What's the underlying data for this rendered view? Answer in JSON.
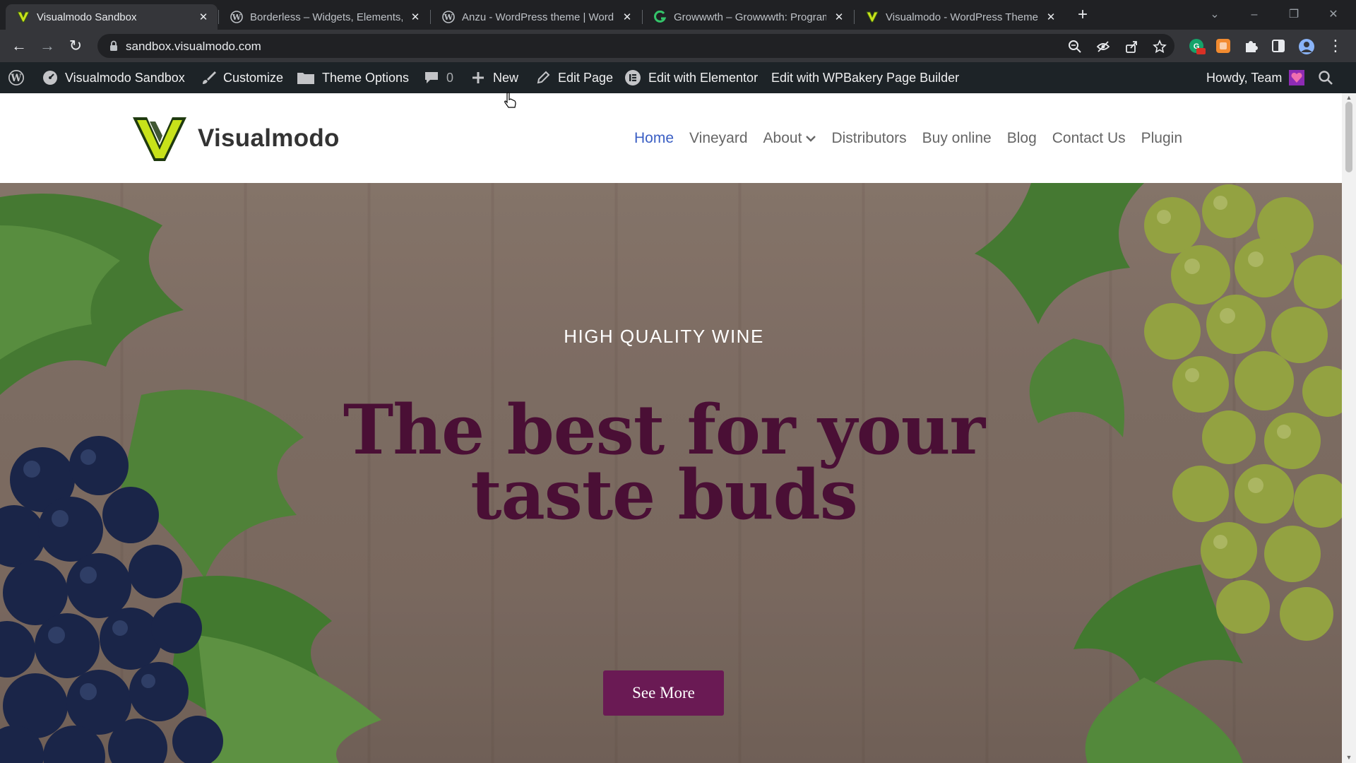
{
  "browser": {
    "tabs": [
      {
        "title": "Visualmodo Sandbox",
        "active": true,
        "favicon": "visualmodo-v-icon"
      },
      {
        "title": "Borderless – Widgets, Elements, T",
        "active": false,
        "favicon": "wordpress-icon"
      },
      {
        "title": "Anzu - WordPress theme | WordP",
        "active": false,
        "favicon": "wordpress-icon"
      },
      {
        "title": "Growwwth – Growwwth: Program",
        "active": false,
        "favicon": "growwwth-icon"
      },
      {
        "title": "Visualmodo - WordPress Themes",
        "active": false,
        "favicon": "visualmodo-v-icon"
      }
    ],
    "url": "sandbox.visualmodo.com"
  },
  "adminbar": {
    "site_name": "Visualmodo Sandbox",
    "customize": "Customize",
    "theme_options": "Theme Options",
    "comments_count": "0",
    "new": "New",
    "edit_page": "Edit Page",
    "edit_elementor": "Edit with Elementor",
    "edit_wpbakery": "Edit with WPBakery Page Builder",
    "howdy": "Howdy, Team"
  },
  "site": {
    "brand": "Visualmodo",
    "nav": [
      {
        "label": "Home",
        "current": true
      },
      {
        "label": "Vineyard"
      },
      {
        "label": "About",
        "dropdown": true
      },
      {
        "label": "Distributors"
      },
      {
        "label": "Buy online"
      },
      {
        "label": "Blog"
      },
      {
        "label": "Contact Us"
      },
      {
        "label": "Plugin"
      }
    ]
  },
  "hero": {
    "kicker": "HIGH QUALITY WINE",
    "headline_line1": "The best for your",
    "headline_line2": "taste buds",
    "cta": "See More"
  },
  "colors": {
    "accent_nav": "#3b5fc4",
    "headline": "#4a0f35",
    "cta_bg": "#6a1a54",
    "adminbar_bg": "#1d2327"
  }
}
